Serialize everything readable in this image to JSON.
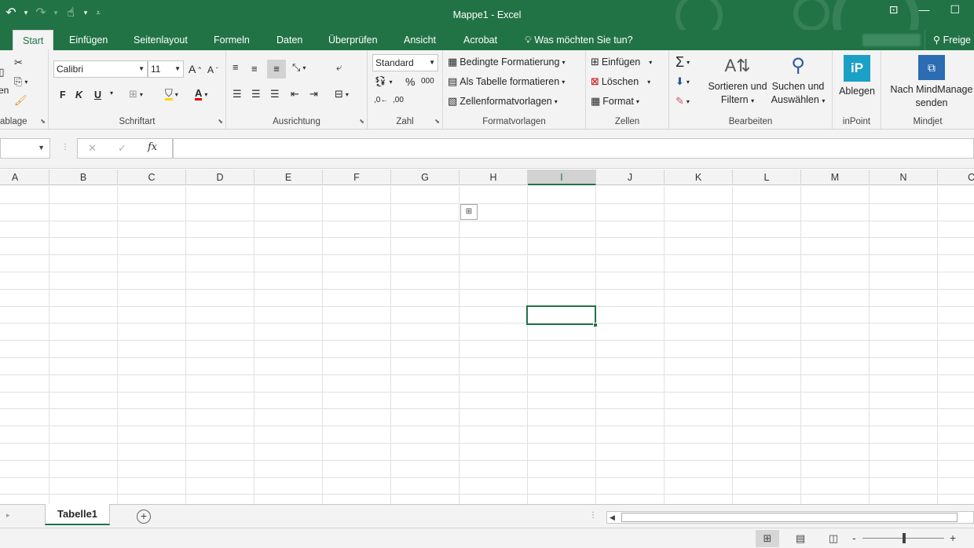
{
  "window": {
    "title": "Mappe1 - Excel",
    "controls": [
      "restore-ribbon-icon",
      "minimize-icon",
      "maximize-icon"
    ]
  },
  "qat": {
    "undo_icon": "undo-icon",
    "redo_icon": "redo-icon",
    "touch_icon": "touch-mode-icon",
    "customize_icon": "customize-qat-icon"
  },
  "tabs": [
    {
      "label": "Start",
      "active": true
    },
    {
      "label": "Einfügen"
    },
    {
      "label": "Seitenlayout"
    },
    {
      "label": "Formeln"
    },
    {
      "label": "Daten"
    },
    {
      "label": "Überprüfen"
    },
    {
      "label": "Ansicht"
    },
    {
      "label": "Acrobat"
    }
  ],
  "tell_me": "Was möchten Sie tun?",
  "share": "Freige",
  "ribbon": {
    "clipboard": {
      "label": "ablage"
    },
    "clipboard_stub": "en",
    "font": {
      "label": "Schriftart",
      "font_name": "Calibri",
      "font_size": "11",
      "grow": "A",
      "shrink": "A",
      "bold": "F",
      "italic": "K",
      "underline": "U"
    },
    "alignment": {
      "label": "Ausrichtung"
    },
    "number": {
      "label": "Zahl",
      "format": "Standard",
      "percent": "%",
      "thousands": "000",
      "inc_dec": ",0←",
      "dec_dec": ",00"
    },
    "styles": {
      "label": "Formatvorlagen",
      "conditional": "Bedingte Formatierung",
      "as_table": "Als Tabelle formatieren",
      "cell_styles": "Zellenformatvorlagen"
    },
    "cells": {
      "label": "Zellen",
      "insert": "Einfügen",
      "delete": "Löschen",
      "format": "Format"
    },
    "editing": {
      "label": "Bearbeiten",
      "sort_1": "Sortieren und",
      "sort_2": "Filtern",
      "find_1": "Suchen und",
      "find_2": "Auswählen"
    },
    "inpoint": {
      "label": "inPoint",
      "button": "Ablegen",
      "logo": "iP"
    },
    "mindjet": {
      "label": "Mindjet",
      "button_1": "Nach MindManage",
      "button_2": "senden"
    }
  },
  "formula_bar": {
    "name_box": "",
    "fx": "fx",
    "value": ""
  },
  "columns": [
    "A",
    "B",
    "C",
    "D",
    "E",
    "F",
    "G",
    "H",
    "I",
    "J",
    "K",
    "L",
    "M",
    "N",
    "O"
  ],
  "selected_column": "I",
  "sheets": [
    {
      "name": "Tabelle1",
      "active": true
    }
  ],
  "add_sheet": "+",
  "status": {
    "zoom_minus": "-",
    "zoom_plus": "+"
  }
}
